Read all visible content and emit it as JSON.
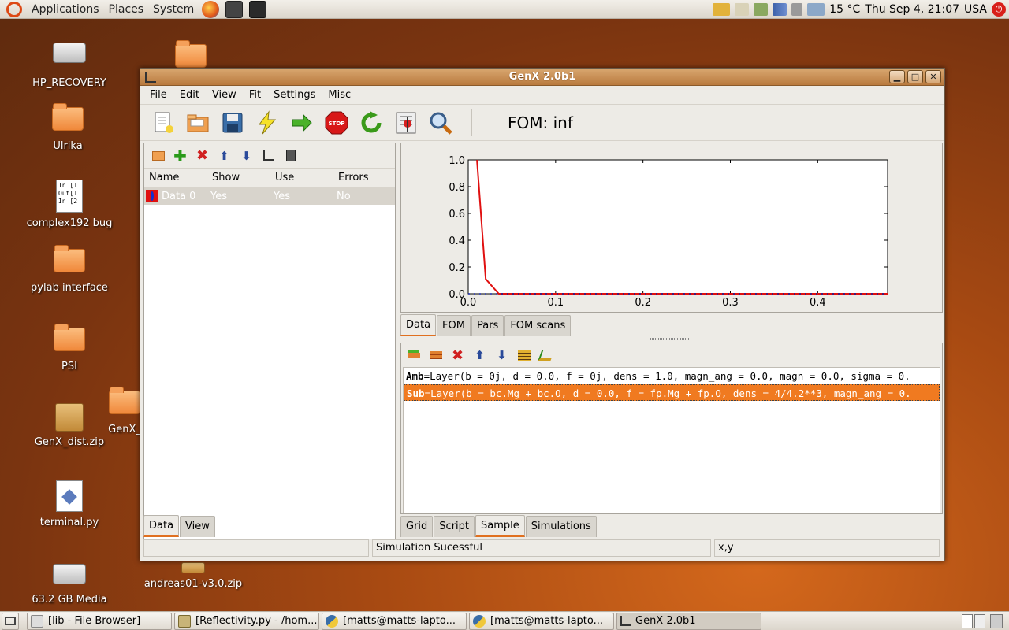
{
  "top_panel": {
    "menus": [
      "Applications",
      "Places",
      "System"
    ],
    "weather": "15 °C",
    "clock": "Thu Sep  4, 21:07",
    "keyboard": "USA"
  },
  "desktop_icons": [
    {
      "label": "HP_RECOVERY",
      "kind": "drive-icon"
    },
    {
      "label": "Ulrika",
      "kind": "folder-icon"
    },
    {
      "label": "complex192 bug",
      "kind": "document-icon",
      "preview": [
        "In [1",
        "Out[1",
        "In [2"
      ]
    },
    {
      "label": "pylab interface",
      "kind": "folder-icon"
    },
    {
      "label": "PSI",
      "kind": "folder-icon"
    },
    {
      "label": "GenX_dist.zip",
      "kind": "archive-icon"
    },
    {
      "label": "terminal.py",
      "kind": "python-file-icon"
    },
    {
      "label": "63.2 GB Media",
      "kind": "drive-icon"
    },
    {
      "label": "GenX_",
      "kind": "folder-icon"
    },
    {
      "label": "andreas01-v3.0.zip",
      "kind": "archive-icon"
    }
  ],
  "window": {
    "title": "GenX 2.0b1",
    "menu": [
      "File",
      "Edit",
      "View",
      "Fit",
      "Settings",
      "Misc"
    ],
    "fom": "FOM: inf",
    "data_list": {
      "columns": [
        "Name",
        "Show",
        "Use",
        "Errors"
      ],
      "rows": [
        {
          "name": "Data 0",
          "show": "Yes",
          "use": "Yes",
          "errors": "No"
        }
      ]
    },
    "left_tabs": [
      "Data",
      "View"
    ],
    "plot_tabs": [
      "Data",
      "FOM",
      "Pars",
      "FOM scans"
    ],
    "sample_tabs": [
      "Grid",
      "Script",
      "Sample",
      "Simulations"
    ],
    "layers": [
      {
        "name": "Amb",
        "def": "=Layer(b = 0j, d = 0.0, f = 0j, dens = 1.0, magn_ang = 0.0, magn = 0.0, sigma = 0."
      },
      {
        "name": "Sub",
        "def": "=Layer(b = bc.Mg + bc.O, d = 0.0, f = fp.Mg + fp.O, dens = 4/4.2**3, magn_ang = 0."
      }
    ],
    "status": {
      "left": "",
      "middle": "Simulation Sucessful",
      "right": "x,y"
    }
  },
  "chart_data": {
    "type": "line",
    "xlim": [
      0.0,
      0.48
    ],
    "ylim": [
      0.0,
      1.0
    ],
    "xticks": [
      "0.0",
      "0.1",
      "0.2",
      "0.3",
      "0.4"
    ],
    "yticks": [
      "0.0",
      "0.2",
      "0.4",
      "0.6",
      "0.8",
      "1.0"
    ],
    "series": [
      {
        "color": "#e01010",
        "x": [
          0.01,
          0.02,
          0.035,
          0.05,
          0.48
        ],
        "y": [
          1.0,
          0.11,
          0.0,
          0.0,
          0.0
        ]
      },
      {
        "color": "#1020a0",
        "style": "dots",
        "x": [
          0.0,
          0.48
        ],
        "y": [
          0.0,
          0.0
        ]
      }
    ]
  },
  "taskbar": [
    {
      "label": "[lib - File Browser]"
    },
    {
      "label": "[Reflectivity.py - /hom..."
    },
    {
      "label": "[matts@matts-lapto..."
    },
    {
      "label": "[matts@matts-lapto..."
    },
    {
      "label": "GenX 2.0b1"
    }
  ]
}
